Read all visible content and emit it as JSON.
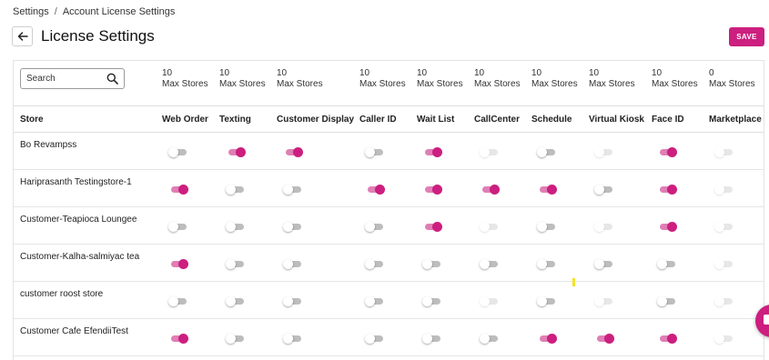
{
  "breadcrumb": {
    "root": "Settings",
    "separator": "/",
    "current": "Account License Settings"
  },
  "header": {
    "title": "License Settings",
    "save_label": "SAVE"
  },
  "search": {
    "placeholder": "Search"
  },
  "colors": {
    "accent": "#cc1f7f",
    "toggle_off": "#bdbdbd"
  },
  "max_stores_label": "Max Stores",
  "columns": [
    {
      "key": "web_order",
      "label": "Web Order",
      "max": "10"
    },
    {
      "key": "texting",
      "label": "Texting",
      "max": "10"
    },
    {
      "key": "customer_display",
      "label": "Customer Display",
      "max": "10"
    },
    {
      "key": "caller_id",
      "label": "Caller ID",
      "max": "10"
    },
    {
      "key": "wait_list",
      "label": "Wait List",
      "max": "10"
    },
    {
      "key": "callcenter",
      "label": "CallCenter",
      "max": "10"
    },
    {
      "key": "schedule",
      "label": "Schedule",
      "max": "10"
    },
    {
      "key": "virtual_kiosk",
      "label": "Virtual Kiosk",
      "max": "10"
    },
    {
      "key": "face_id",
      "label": "Face ID",
      "max": "10"
    },
    {
      "key": "marketplace",
      "label": "Marketplace",
      "max": "0"
    }
  ],
  "store_header": "Store",
  "rows": [
    {
      "store": "Bo Revampss",
      "toggles": [
        "off",
        "on",
        "on",
        "off",
        "on",
        "disabled",
        "off",
        "disabled",
        "on",
        "disabled"
      ]
    },
    {
      "store": "Hariprasanth Testingstore-1",
      "toggles": [
        "on",
        "off",
        "off",
        "on",
        "on",
        "on",
        "on",
        "off",
        "on",
        "disabled"
      ]
    },
    {
      "store": "Customer-Teapioca Loungee",
      "toggles": [
        "off",
        "off",
        "off",
        "off",
        "on",
        "disabled",
        "off",
        "disabled",
        "on",
        "disabled"
      ]
    },
    {
      "store": "Customer-Kalha-salmiyac tea",
      "toggles": [
        "on",
        "off",
        "off",
        "off",
        "off",
        "off",
        "off",
        "off",
        "off",
        "disabled"
      ]
    },
    {
      "store": "customer roost store",
      "toggles": [
        "off",
        "off",
        "off",
        "off",
        "off",
        "disabled",
        "off",
        "disabled",
        "off",
        "disabled"
      ]
    },
    {
      "store": "Customer Cafe EfendiiTest",
      "toggles": [
        "on",
        "off",
        "off",
        "off",
        "off",
        "off",
        "on",
        "on",
        "on",
        "disabled"
      ]
    }
  ]
}
